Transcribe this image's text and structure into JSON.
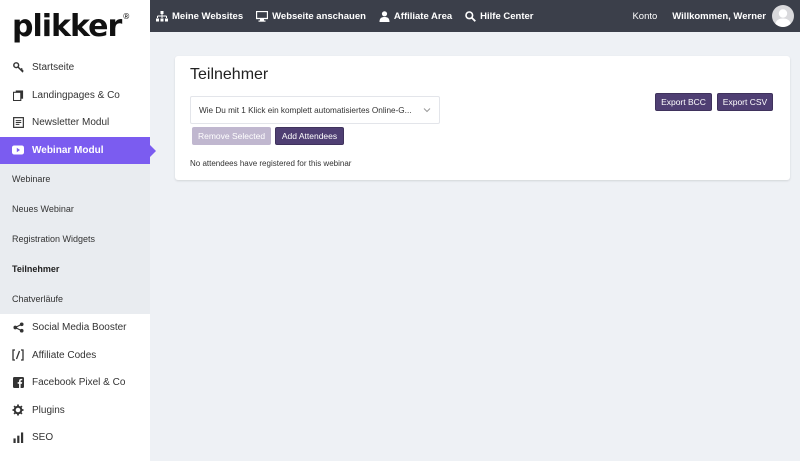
{
  "brand": {
    "logo_text": "plikker",
    "registered_mark": "®"
  },
  "topbar": {
    "links": [
      {
        "label": "Meine Websites",
        "icon": "sitemap-icon"
      },
      {
        "label": "Webseite anschauen",
        "icon": "monitor-icon"
      },
      {
        "label": "Affiliate Area",
        "icon": "user-icon"
      },
      {
        "label": "Hilfe Center",
        "icon": "search-icon"
      }
    ],
    "account_label": "Konto",
    "welcome_text": "Willkommen, Werner"
  },
  "sidebar": {
    "items": [
      {
        "label": "Startseite",
        "icon": "key-icon"
      },
      {
        "label": "Landingpages & Co",
        "icon": "pages-icon"
      },
      {
        "label": "Newsletter Modul",
        "icon": "newspaper-icon"
      },
      {
        "label": "Webinar Modul",
        "icon": "youtube-icon",
        "active": true
      }
    ],
    "sub_items": [
      {
        "label": "Webinare"
      },
      {
        "label": "Neues Webinar"
      },
      {
        "label": "Registration Widgets"
      },
      {
        "label": "Teilnehmer",
        "current": true
      },
      {
        "label": "Chatverläufe"
      }
    ],
    "bottom_items": [
      {
        "label": "Social Media Booster",
        "icon": "share-icon"
      },
      {
        "label": "Affiliate Codes",
        "icon": "code-icon"
      },
      {
        "label": "Facebook Pixel & Co",
        "icon": "facebook-icon"
      },
      {
        "label": "Plugins",
        "icon": "gear-icon"
      },
      {
        "label": "SEO",
        "icon": "bar-chart-icon"
      }
    ]
  },
  "main": {
    "title": "Teilnehmer",
    "webinar_select_value": "Wie Du mit 1 Klick ein komplett automatisiertes Online-G...",
    "remove_button": "Remove Selected",
    "add_button": "Add Attendees",
    "export_bcc_button": "Export BCC",
    "export_csv_button": "Export CSV",
    "empty_message": "No attendees have registered for this webinar"
  },
  "colors": {
    "accent": "#7b5cf0",
    "button": "#4f3f73",
    "topbar": "#3b3f4a",
    "background": "#eef1f5"
  }
}
